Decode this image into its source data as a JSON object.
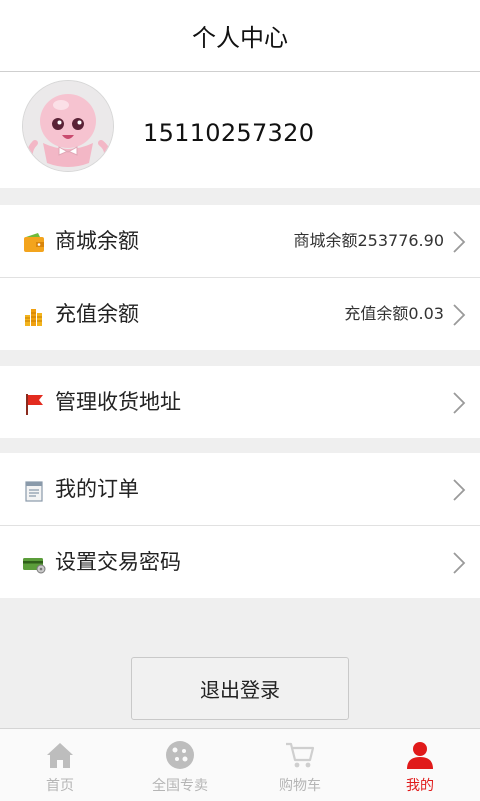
{
  "header": {
    "title": "个人中心"
  },
  "profile": {
    "phone": "15110257320",
    "avatar_icon": "octopus-avatar"
  },
  "accounts": [
    {
      "icon": "wallet-icon",
      "label": "商城余额",
      "value": "商城余额253776.90"
    },
    {
      "icon": "coins-icon",
      "label": "充值余额",
      "value": "充值余额0.03"
    }
  ],
  "address": {
    "icon": "flag-icon",
    "label": "管理收货地址"
  },
  "orders": [
    {
      "icon": "receipt-icon",
      "label": "我的订单"
    },
    {
      "icon": "card-key-icon",
      "label": "设置交易密码"
    }
  ],
  "logout_label": "退出登录",
  "tabs": [
    {
      "icon": "home-icon",
      "label": "首页",
      "active": false
    },
    {
      "icon": "globe-icon",
      "label": "全国专卖",
      "active": false
    },
    {
      "icon": "cart-icon",
      "label": "购物车",
      "active": false
    },
    {
      "icon": "user-icon",
      "label": "我的",
      "active": true
    }
  ],
  "colors": {
    "accent": "#e01a1a",
    "inactive_tab": "#b5b5b5",
    "background": "#efefef"
  }
}
